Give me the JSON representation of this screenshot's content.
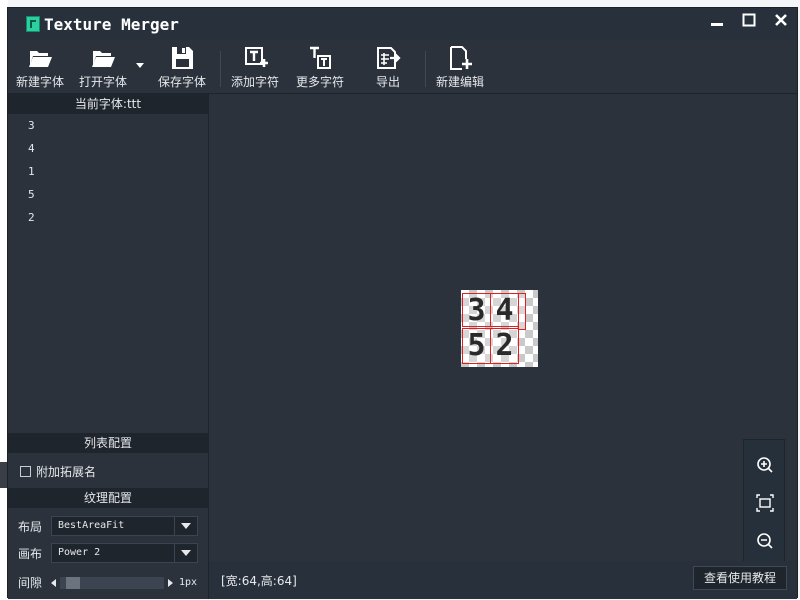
{
  "window": {
    "title": "Texture Merger",
    "controls": {
      "minimize": "▁",
      "maximize": "□",
      "close": "✕"
    }
  },
  "toolbar": {
    "new_font": "新建字体",
    "open_font": "打开字体",
    "save_font": "保存字体",
    "add_char": "添加字符",
    "more_chars": "更多字符",
    "export": "导出",
    "new_edit": "新建编辑"
  },
  "left_panel": {
    "header": "当前字体:ttt",
    "items": [
      "3",
      "4",
      "1",
      "5",
      "2"
    ],
    "list_config_header": "列表配置",
    "append_ext_label": "附加拓展名",
    "append_ext_checked": false,
    "texture_config_header": "纹理配置",
    "layout_label": "布局",
    "layout_value": "BestAreaFit",
    "canvas_label": "画布",
    "canvas_value": "Power 2",
    "spacing_label": "间隙",
    "spacing_value": "1px"
  },
  "canvas": {
    "glyphs": [
      "3",
      "4",
      "!",
      "5",
      "2"
    ]
  },
  "status": {
    "size_text": "[宽:64,高:64]",
    "help_button": "查看使用教程"
  },
  "colors": {
    "window_bg": "#2b323c",
    "header_bg": "#1f252d",
    "glyph_border": "#e02020",
    "accent_icon": "#2ad0a0"
  }
}
